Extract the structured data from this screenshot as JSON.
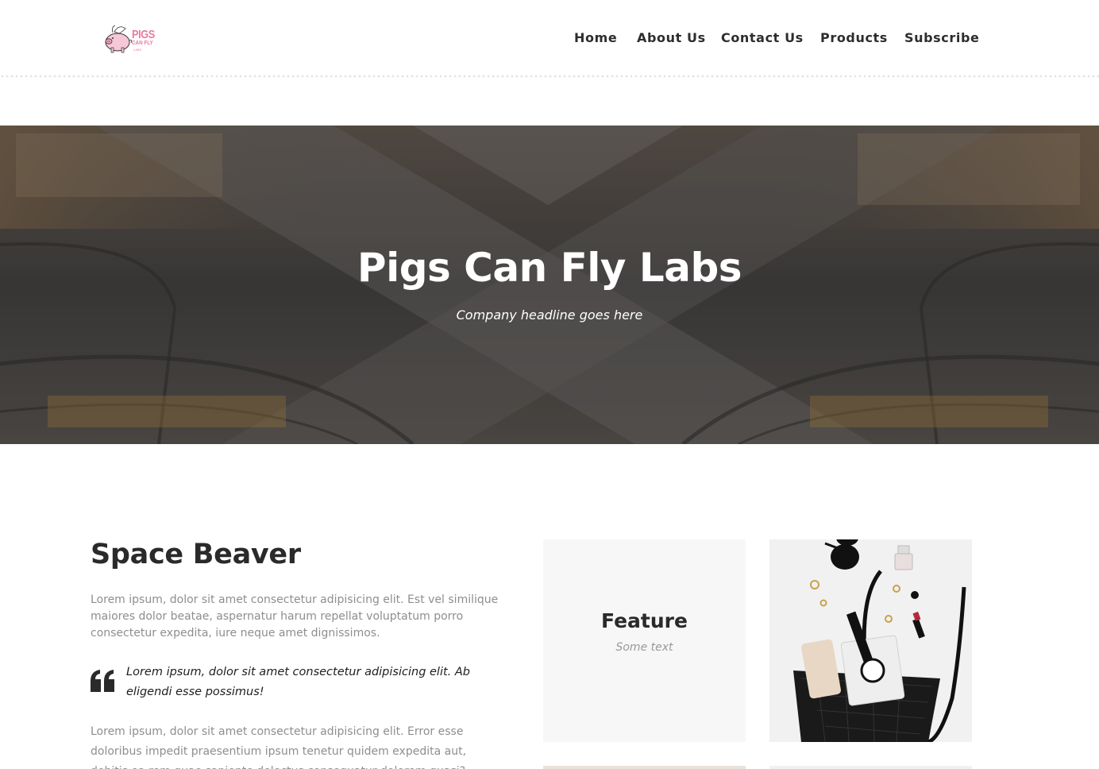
{
  "header": {
    "logo": {
      "line1": "PIGS",
      "line2": "CAN FLY",
      "line3": "LABS"
    },
    "nav": [
      {
        "label": "Home"
      },
      {
        "label": "About Us"
      },
      {
        "label": "Contact Us"
      },
      {
        "label": "Products"
      },
      {
        "label": "Subscribe"
      }
    ]
  },
  "hero": {
    "title": "Pigs Can Fly Labs",
    "subtitle": "Company headline goes here"
  },
  "content": {
    "title": "Space Beaver",
    "paragraph1": "Lorem ipsum, dolor sit amet consectetur adipisicing elit. Est vel similique maiores dolor beatae, aspernatur harum repellat voluptatum porro consectetur expedita, iure neque amet dignissimos.",
    "quote": "Lorem ipsum, dolor sit amet consectetur adipisicing elit. Ab eligendi esse possimus!",
    "paragraph2": "Lorem ipsum, dolor sit amet consectetur adipisicing elit. Error esse doloribus impedit praesentium ipsum tenetur quidem expedita aut, debitis ea rem quae sapiente delectus consequatur dolorem quasi?"
  },
  "feature": {
    "title": "Feature",
    "subtitle": "Some text"
  },
  "colors": {
    "logo_pink": "#e87aa2",
    "text_dark": "#2a2a2a",
    "text_muted": "#8e8e8e",
    "card_bg": "#f7f7f7"
  }
}
